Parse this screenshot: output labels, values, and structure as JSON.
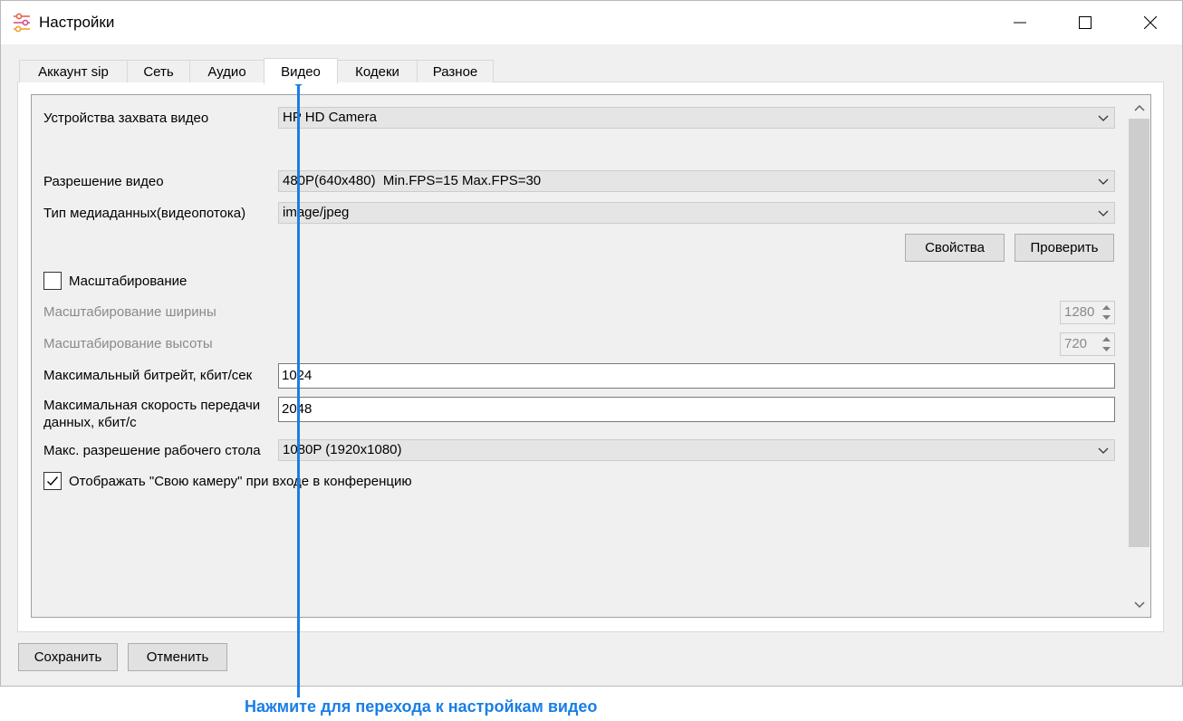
{
  "window": {
    "title": "Настройки"
  },
  "tabs": [
    "Аккаунт sip",
    "Сеть",
    "Аудио",
    "Видео",
    "Кодеки",
    "Разное"
  ],
  "active_tab": "Видео",
  "video": {
    "capture_device": {
      "label": "Устройства захвата видео",
      "value": "HP HD Camera"
    },
    "resolution": {
      "label": "Разрешение видео",
      "value": "480P(640x480)  Min.FPS=15 Max.FPS=30"
    },
    "media_type": {
      "label": "Тип медиаданных(видеопотока)",
      "value": "image/jpeg"
    },
    "properties_button": "Свойства",
    "check_button": "Проверить",
    "scaling": {
      "label": "Масштабирование",
      "checked": false
    },
    "scale_width": {
      "label": "Масштабирование ширины",
      "value": "1280"
    },
    "scale_height": {
      "label": "Масштабирование высоты",
      "value": "720"
    },
    "max_bitrate": {
      "label": "Максимальный битрейт, кбит/сек",
      "value": "1024"
    },
    "max_rate": {
      "label_line1": "Максимальная скорость передачи",
      "label_line2": "данных, кбит/с",
      "value": "2048"
    },
    "desktop_resolution": {
      "label": "Макс. разрешение рабочего стола",
      "value": "1080P (1920x1080)"
    },
    "show_own_camera": {
      "label": "Отображать \"Свою камеру\" при входе в конференцию",
      "checked": true
    }
  },
  "footer": {
    "save": "Сохранить",
    "cancel": "Отменить"
  },
  "annotation": {
    "text": "Нажмите для перехода к настройкам видео",
    "color": "#1a7ee6"
  }
}
